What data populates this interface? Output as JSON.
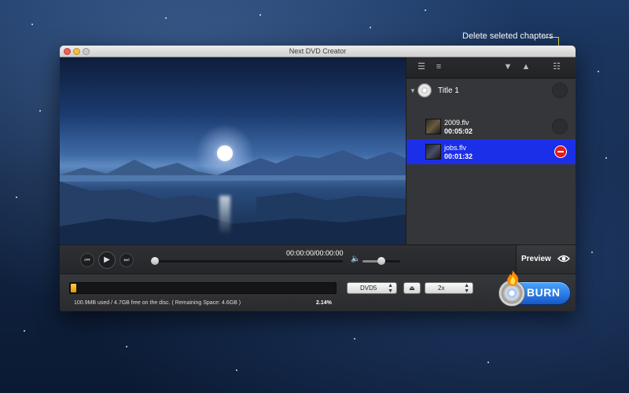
{
  "callout": {
    "text": "Delete seleted chapters"
  },
  "window": {
    "title": "Next DVD Creator"
  },
  "panel": {
    "title_item": {
      "label": "Title 1"
    },
    "chapters": [
      {
        "name": "2009.flv",
        "duration": "00:05:02"
      },
      {
        "name": "jobs.flv",
        "duration": "00:01:32"
      }
    ]
  },
  "player": {
    "time": "00:00:00/00:00:00"
  },
  "preview": {
    "label": "Preview"
  },
  "disc": {
    "progress_fraction": 0.0214,
    "usage_text": "100.9MB used / 4.7GB free on the disc.  ( Remaining Space: 4.6GB )",
    "percent": "2.14%",
    "type_selected": "DVD5",
    "speed_selected": "2x"
  },
  "burn": {
    "label": "BURN"
  },
  "colors": {
    "selection": "#1b2fe8",
    "accent": "#e8d94a",
    "burn": "#1f6fe0",
    "progress": "#f5b51d",
    "delete": "#e41b1b"
  },
  "icons": [
    "menu-icon",
    "list-icon",
    "arrow-down-icon",
    "arrow-up-icon",
    "tree-icon",
    "disc-icon",
    "delete-icon",
    "previous-icon",
    "play-icon",
    "next-icon",
    "volume-icon",
    "eye-icon",
    "eject-icon",
    "flame-icon"
  ]
}
